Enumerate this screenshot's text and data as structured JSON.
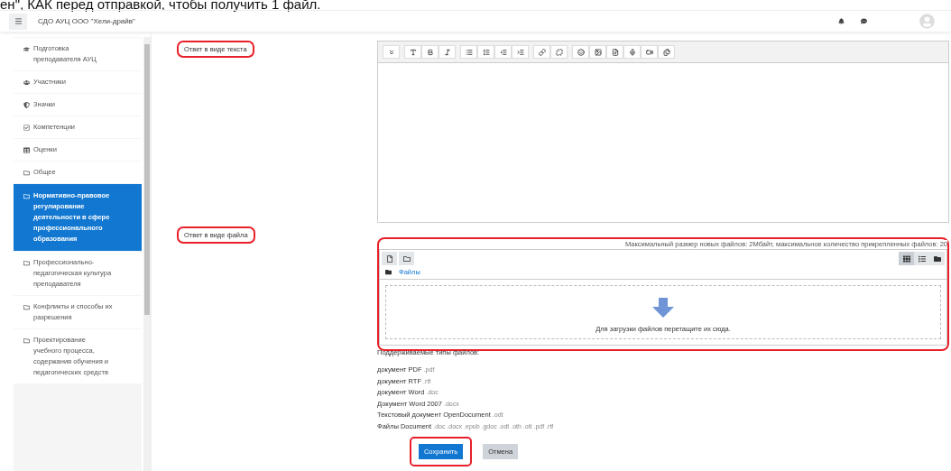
{
  "caption": "ен\", КАК перед отправкой, чтобы получить 1 файл.",
  "navbar": {
    "title": "СДО АУЦ ООО \"Хели-драйв\""
  },
  "sidebar": {
    "items": [
      {
        "label": "Подготовка преподавателя АУЦ",
        "selected": false
      },
      {
        "label": "Участники",
        "selected": false
      },
      {
        "label": "Значки",
        "selected": false
      },
      {
        "label": "Компетенции",
        "selected": false
      },
      {
        "label": "Оценки",
        "selected": false
      },
      {
        "label": "Общее",
        "selected": false
      },
      {
        "label": "Нормативно-правовое регулирование деятельности в сфере профессионального образования",
        "selected": true
      },
      {
        "label": "Профессионально-педагогическая культура преподавателя",
        "selected": false
      },
      {
        "label": "Конфликты и способы их разрешения",
        "selected": false
      },
      {
        "label": "Проектирование учебного процесса, содержания обучения и педагогических средств",
        "selected": false
      }
    ]
  },
  "fields": [
    {
      "kind": "editor",
      "label": "Ответ в виде текста",
      "highlighted": true
    },
    {
      "kind": "files",
      "label": "Ответ в виде файла",
      "highlighted": true,
      "limits": "Максимальный размер новых файлов: 2Мбайт, максимальное количество прикрепленных файлов: 20",
      "views": [
        {
          "selected": true
        },
        {
          "selected": false
        },
        {
          "selected": false
        }
      ],
      "path": "Файлы",
      "drop_hint": "Для загрузки файлов перетащите их сюда.",
      "types_heading": "Поддерживаемые типы файлов:",
      "types": [
        {
          "name": "документ PDF",
          "ext": ".pdf"
        },
        {
          "name": "документ RTF",
          "ext": ".rtf"
        },
        {
          "name": "документ Word",
          "ext": ".doc"
        },
        {
          "name": "Документ Word 2007",
          "ext": ".docx"
        },
        {
          "name": "Текстовый документ OpenDocument",
          "ext": ".odt"
        },
        {
          "name": "Файлы Document",
          "ext": ".doc .docx .epub .gdoc .odt .oth .ott .pdf .rtf"
        }
      ]
    }
  ],
  "buttons": [
    {
      "label": "Сохранить",
      "kind": "primary",
      "highlighted": true
    },
    {
      "label": "Отмена",
      "kind": "secondary",
      "highlighted": false
    }
  ]
}
